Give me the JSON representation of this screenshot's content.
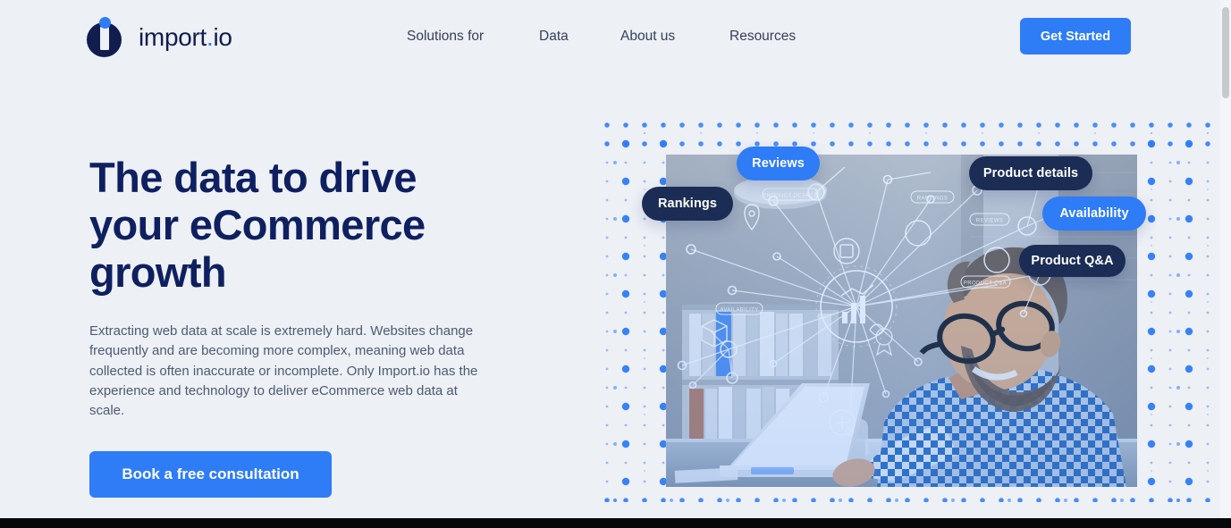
{
  "brand": {
    "name_main": "import",
    "name_dot": ".",
    "name_tld": "io",
    "logo_icon": "import-io-logo-icon"
  },
  "nav": {
    "items": [
      {
        "label": "Solutions for"
      },
      {
        "label": "Data"
      },
      {
        "label": "About us"
      },
      {
        "label": "Resources"
      }
    ],
    "cta_label": "Get Started"
  },
  "hero": {
    "title": "The data to drive your eCommerce growth",
    "subtitle": "Extracting web data at scale is extremely hard. Websites change frequently and are becoming more complex, meaning web data collected is often inaccurate or incomplete. Only Import.io has the experience and technology to deliver eCommerce web data at scale.",
    "cta_label": "Book a free consultation",
    "image_alt": "Man with glasses and blue checkered shirt working on a laptop at an office desk with a white data-network overlay graphic",
    "pills": [
      {
        "label": "Reviews",
        "style": "blue"
      },
      {
        "label": "Rankings",
        "style": "navy"
      },
      {
        "label": "Product details",
        "style": "navy"
      },
      {
        "label": "Availability",
        "style": "blue"
      },
      {
        "label": "Product Q&A",
        "style": "navy"
      }
    ],
    "overlay_tags": [
      "PRODUCT DETAILS",
      "RANKINGS",
      "REVIEWS",
      "PRODUCT Q&A",
      "AVAILABILITY"
    ]
  },
  "colors": {
    "page_background": "#edf0f5",
    "brand_navy": "#111d4e",
    "accent_blue": "#2e7cf6",
    "heading_navy": "#0e2060",
    "body_text": "#4d5b72",
    "pill_navy": "#1b2d54",
    "dot_blue": "#2e7cf6",
    "scrollbar_thumb": "#c6c9cd",
    "bottom_bar": "#07070a"
  }
}
